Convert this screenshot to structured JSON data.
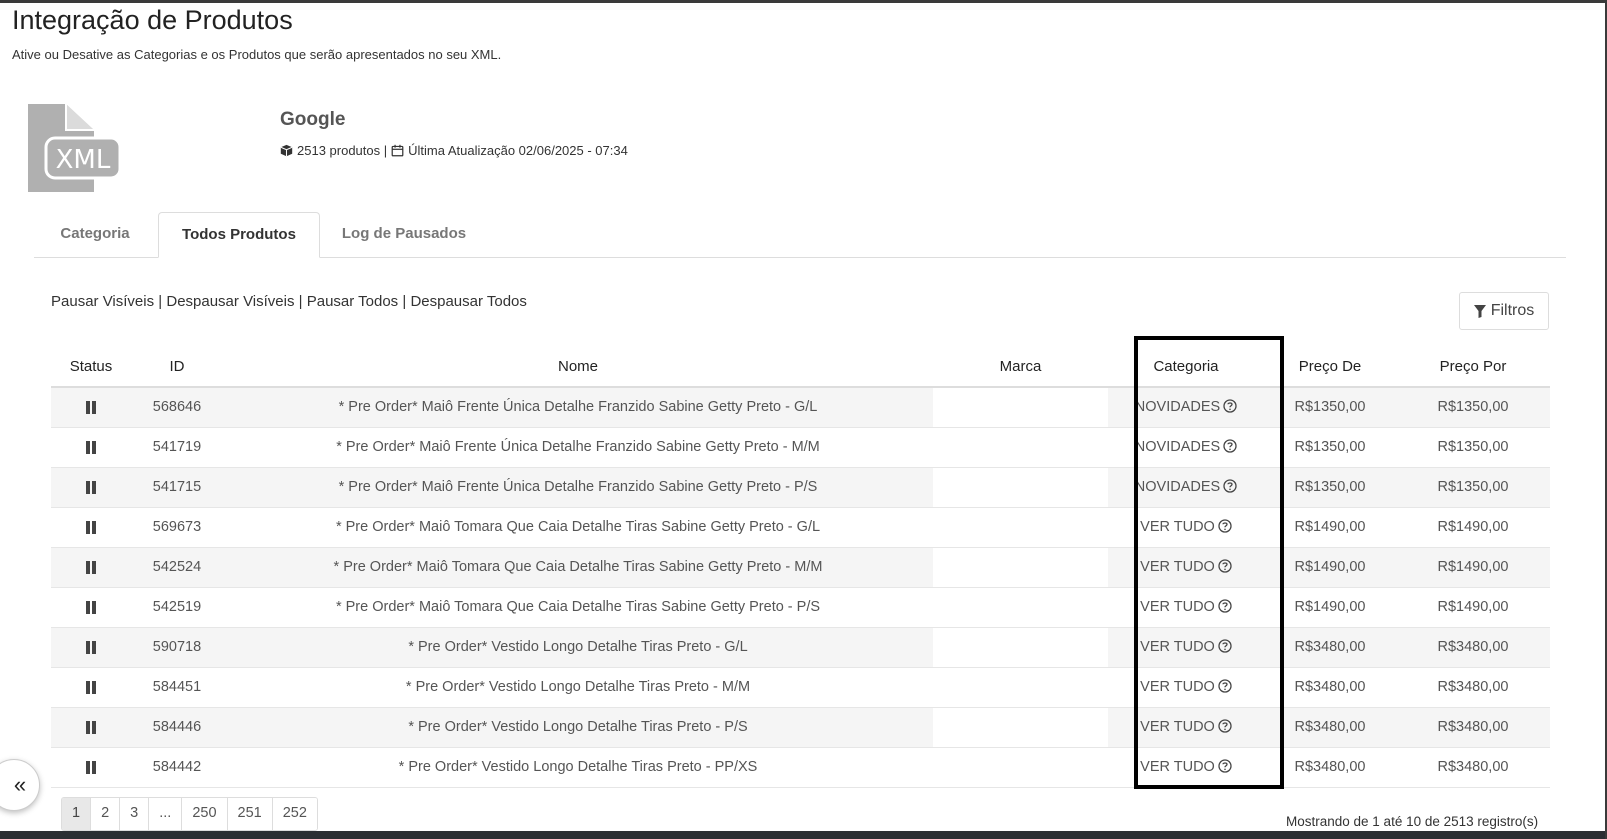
{
  "header": {
    "title": "Integração de Produtos",
    "subtitle": "Ative ou Desative as Categorias e os Produtos que serão apresentados no seu XML."
  },
  "feed": {
    "icon": "xml-file-icon",
    "icon_text": "XML",
    "name": "Google",
    "product_count": "2513 produtos |",
    "last_update": "Última Atualização 02/06/2025 - 07:34"
  },
  "tabs": [
    {
      "label": "Categoria",
      "active": false
    },
    {
      "label": "Todos Produtos",
      "active": true
    },
    {
      "label": "Log de Pausados",
      "active": false
    }
  ],
  "bulk_actions": {
    "pause_visible": "Pausar Visíveis",
    "unpause_visible": "Despausar Visíveis",
    "pause_all": "Pausar Todos",
    "unpause_all": "Despausar Todos",
    "separator": "|"
  },
  "filter_button": {
    "label": "Filtros",
    "icon": "filter-icon"
  },
  "table": {
    "headers": {
      "status": "Status",
      "id": "ID",
      "nome": "Nome",
      "marca": "Marca",
      "categoria": "Categoria",
      "preco_de": "Preço De",
      "preco_por": "Preço Por"
    },
    "rows": [
      {
        "id": "568646",
        "nome": "* Pre Order* Maiô Frente Única Detalhe Franzido Sabine Getty Preto - G/L",
        "marca": "",
        "categoria": "NOVIDADES",
        "preco_de": "R$1350,00",
        "preco_por": "R$1350,00"
      },
      {
        "id": "541719",
        "nome": "* Pre Order* Maiô Frente Única Detalhe Franzido Sabine Getty Preto - M/M",
        "marca": "",
        "categoria": "NOVIDADES",
        "preco_de": "R$1350,00",
        "preco_por": "R$1350,00"
      },
      {
        "id": "541715",
        "nome": "* Pre Order* Maiô Frente Única Detalhe Franzido Sabine Getty Preto - P/S",
        "marca": "",
        "categoria": "NOVIDADES",
        "preco_de": "R$1350,00",
        "preco_por": "R$1350,00"
      },
      {
        "id": "569673",
        "nome": "* Pre Order* Maiô Tomara Que Caia Detalhe Tiras Sabine Getty Preto - G/L",
        "marca": "",
        "categoria": "VER TUDO",
        "preco_de": "R$1490,00",
        "preco_por": "R$1490,00"
      },
      {
        "id": "542524",
        "nome": "* Pre Order* Maiô Tomara Que Caia Detalhe Tiras Sabine Getty Preto - M/M",
        "marca": "",
        "categoria": "VER TUDO",
        "preco_de": "R$1490,00",
        "preco_por": "R$1490,00"
      },
      {
        "id": "542519",
        "nome": "* Pre Order* Maiô Tomara Que Caia Detalhe Tiras Sabine Getty Preto - P/S",
        "marca": "",
        "categoria": "VER TUDO",
        "preco_de": "R$1490,00",
        "preco_por": "R$1490,00"
      },
      {
        "id": "590718",
        "nome": "* Pre Order* Vestido Longo Detalhe Tiras Preto - G/L",
        "marca": "",
        "categoria": "VER TUDO",
        "preco_de": "R$3480,00",
        "preco_por": "R$3480,00"
      },
      {
        "id": "584451",
        "nome": "* Pre Order* Vestido Longo Detalhe Tiras Preto - M/M",
        "marca": "",
        "categoria": "VER TUDO",
        "preco_de": "R$3480,00",
        "preco_por": "R$3480,00"
      },
      {
        "id": "584446",
        "nome": "* Pre Order* Vestido Longo Detalhe Tiras Preto - P/S",
        "marca": "",
        "categoria": "VER TUDO",
        "preco_de": "R$3480,00",
        "preco_por": "R$3480,00"
      },
      {
        "id": "584442",
        "nome": "* Pre Order* Vestido Longo Detalhe Tiras Preto - PP/XS",
        "marca": "",
        "categoria": "VER TUDO",
        "preco_de": "R$3480,00",
        "preco_por": "R$3480,00"
      }
    ]
  },
  "pagination": {
    "pages": [
      "1",
      "2",
      "3",
      "...",
      "250",
      "251",
      "252"
    ],
    "active": "1"
  },
  "records_info": "Mostrando de 1 até 10 de 2513 registro(s)",
  "collapse_button": {
    "label": "«"
  }
}
